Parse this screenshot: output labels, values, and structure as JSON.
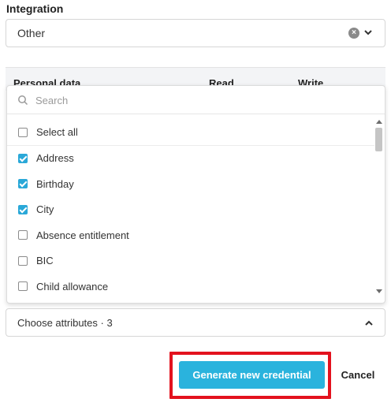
{
  "integration": {
    "label": "Integration",
    "selected": "Other",
    "clear_icon": "clear-icon",
    "chevron_icon": "chevron-down-icon"
  },
  "table": {
    "columns": [
      "Personal data",
      "Read",
      "Write"
    ]
  },
  "attribute_picker": {
    "search_placeholder": "Search",
    "options": [
      {
        "label": "Select all",
        "checked": false
      },
      {
        "label": "Address",
        "checked": true
      },
      {
        "label": "Birthday",
        "checked": true
      },
      {
        "label": "City",
        "checked": true
      },
      {
        "label": "Absence entitlement",
        "checked": false
      },
      {
        "label": "BIC",
        "checked": false
      },
      {
        "label": "Child allowance",
        "checked": false
      }
    ],
    "summary": "Choose attributes · 3",
    "chevron_icon": "chevron-up-icon"
  },
  "actions": {
    "generate_label": "Generate new credential",
    "cancel_label": "Cancel"
  },
  "colors": {
    "accent": "#2ab3dd",
    "checkbox_checked": "#2aa8d8",
    "highlight": "#e3121e"
  }
}
